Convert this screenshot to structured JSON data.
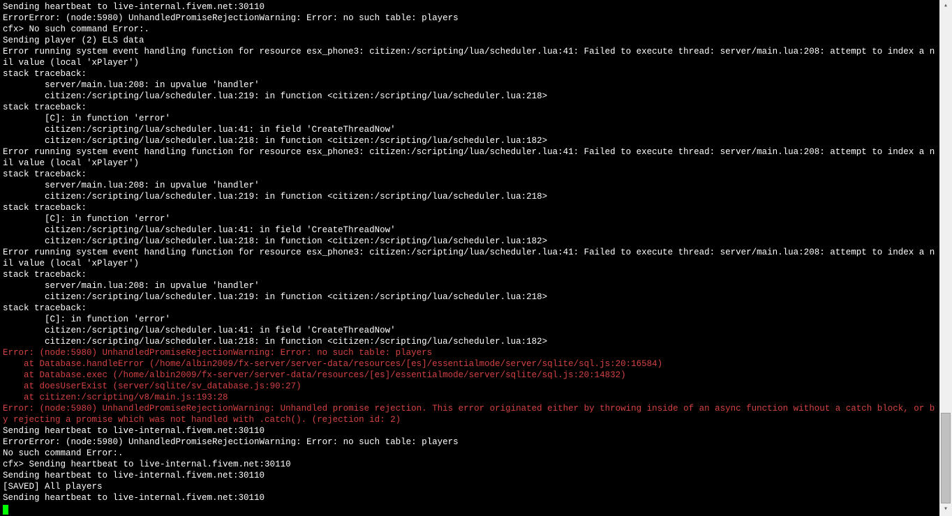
{
  "lines": [
    {
      "text": "Sending heartbeat to live-internal.fivem.net:30110",
      "cls": "line"
    },
    {
      "text": "ErrorError: (node:5980) UnhandledPromiseRejectionWarning: Error: no such table: players",
      "cls": "line"
    },
    {
      "text": "cfx> No such command Error:.",
      "cls": "line"
    },
    {
      "text": "Sending player (2) ELS data",
      "cls": "line"
    },
    {
      "text": "Error running system event handling function for resource esx_phone3: citizen:/scripting/lua/scheduler.lua:41: Failed to execute thread: server/main.lua:208: attempt to index a nil value (local 'xPlayer')",
      "cls": "line"
    },
    {
      "text": "stack traceback:",
      "cls": "line"
    },
    {
      "text": "        server/main.lua:208: in upvalue 'handler'",
      "cls": "line"
    },
    {
      "text": "        citizen:/scripting/lua/scheduler.lua:219: in function <citizen:/scripting/lua/scheduler.lua:218>",
      "cls": "line"
    },
    {
      "text": "stack traceback:",
      "cls": "line"
    },
    {
      "text": "        [C]: in function 'error'",
      "cls": "line"
    },
    {
      "text": "        citizen:/scripting/lua/scheduler.lua:41: in field 'CreateThreadNow'",
      "cls": "line"
    },
    {
      "text": "        citizen:/scripting/lua/scheduler.lua:218: in function <citizen:/scripting/lua/scheduler.lua:182>",
      "cls": "line"
    },
    {
      "text": "Error running system event handling function for resource esx_phone3: citizen:/scripting/lua/scheduler.lua:41: Failed to execute thread: server/main.lua:208: attempt to index a nil value (local 'xPlayer')",
      "cls": "line"
    },
    {
      "text": "stack traceback:",
      "cls": "line"
    },
    {
      "text": "        server/main.lua:208: in upvalue 'handler'",
      "cls": "line"
    },
    {
      "text": "        citizen:/scripting/lua/scheduler.lua:219: in function <citizen:/scripting/lua/scheduler.lua:218>",
      "cls": "line"
    },
    {
      "text": "stack traceback:",
      "cls": "line"
    },
    {
      "text": "        [C]: in function 'error'",
      "cls": "line"
    },
    {
      "text": "        citizen:/scripting/lua/scheduler.lua:41: in field 'CreateThreadNow'",
      "cls": "line"
    },
    {
      "text": "        citizen:/scripting/lua/scheduler.lua:218: in function <citizen:/scripting/lua/scheduler.lua:182>",
      "cls": "line"
    },
    {
      "text": "Error running system event handling function for resource esx_phone3: citizen:/scripting/lua/scheduler.lua:41: Failed to execute thread: server/main.lua:208: attempt to index a nil value (local 'xPlayer')",
      "cls": "line"
    },
    {
      "text": "stack traceback:",
      "cls": "line"
    },
    {
      "text": "        server/main.lua:208: in upvalue 'handler'",
      "cls": "line"
    },
    {
      "text": "        citizen:/scripting/lua/scheduler.lua:219: in function <citizen:/scripting/lua/scheduler.lua:218>",
      "cls": "line"
    },
    {
      "text": "stack traceback:",
      "cls": "line"
    },
    {
      "text": "        [C]: in function 'error'",
      "cls": "line"
    },
    {
      "text": "        citizen:/scripting/lua/scheduler.lua:41: in field 'CreateThreadNow'",
      "cls": "line"
    },
    {
      "text": "        citizen:/scripting/lua/scheduler.lua:218: in function <citizen:/scripting/lua/scheduler.lua:182>",
      "cls": "line"
    },
    {
      "text": "Error: (node:5980) UnhandledPromiseRejectionWarning: Error: no such table: players",
      "cls": "line-red"
    },
    {
      "text": "    at Database.handleError (/home/albin2009/fx-server/server-data/resources/[es]/essentialmode/server/sqlite/sql.js:20:16584)",
      "cls": "line-red"
    },
    {
      "text": "    at Database.exec (/home/albin2009/fx-server/server-data/resources/[es]/essentialmode/server/sqlite/sql.js:20:14832)",
      "cls": "line-red"
    },
    {
      "text": "    at doesUserExist (server/sqlite/sv_database.js:90:27)",
      "cls": "line-red"
    },
    {
      "text": "    at citizen:/scripting/v8/main.js:193:28",
      "cls": "line-red"
    },
    {
      "text": "Error: (node:5980) UnhandledPromiseRejectionWarning: Unhandled promise rejection. This error originated either by throwing inside of an async function without a catch block, or by rejecting a promise which was not handled with .catch(). (rejection id: 2)",
      "cls": "line-red"
    },
    {
      "text": "Sending heartbeat to live-internal.fivem.net:30110",
      "cls": "line"
    },
    {
      "text": "ErrorError: (node:5980) UnhandledPromiseRejectionWarning: Error: no such table: players",
      "cls": "line"
    },
    {
      "text": "No such command Error:.",
      "cls": "line"
    },
    {
      "text": "cfx> Sending heartbeat to live-internal.fivem.net:30110",
      "cls": "line"
    },
    {
      "text": "Sending heartbeat to live-internal.fivem.net:30110",
      "cls": "line"
    },
    {
      "text": "[SAVED] All players",
      "cls": "line"
    },
    {
      "text": "Sending heartbeat to live-internal.fivem.net:30110",
      "cls": "line"
    }
  ],
  "scrollbar": {
    "up": "▴",
    "down": "▾"
  }
}
